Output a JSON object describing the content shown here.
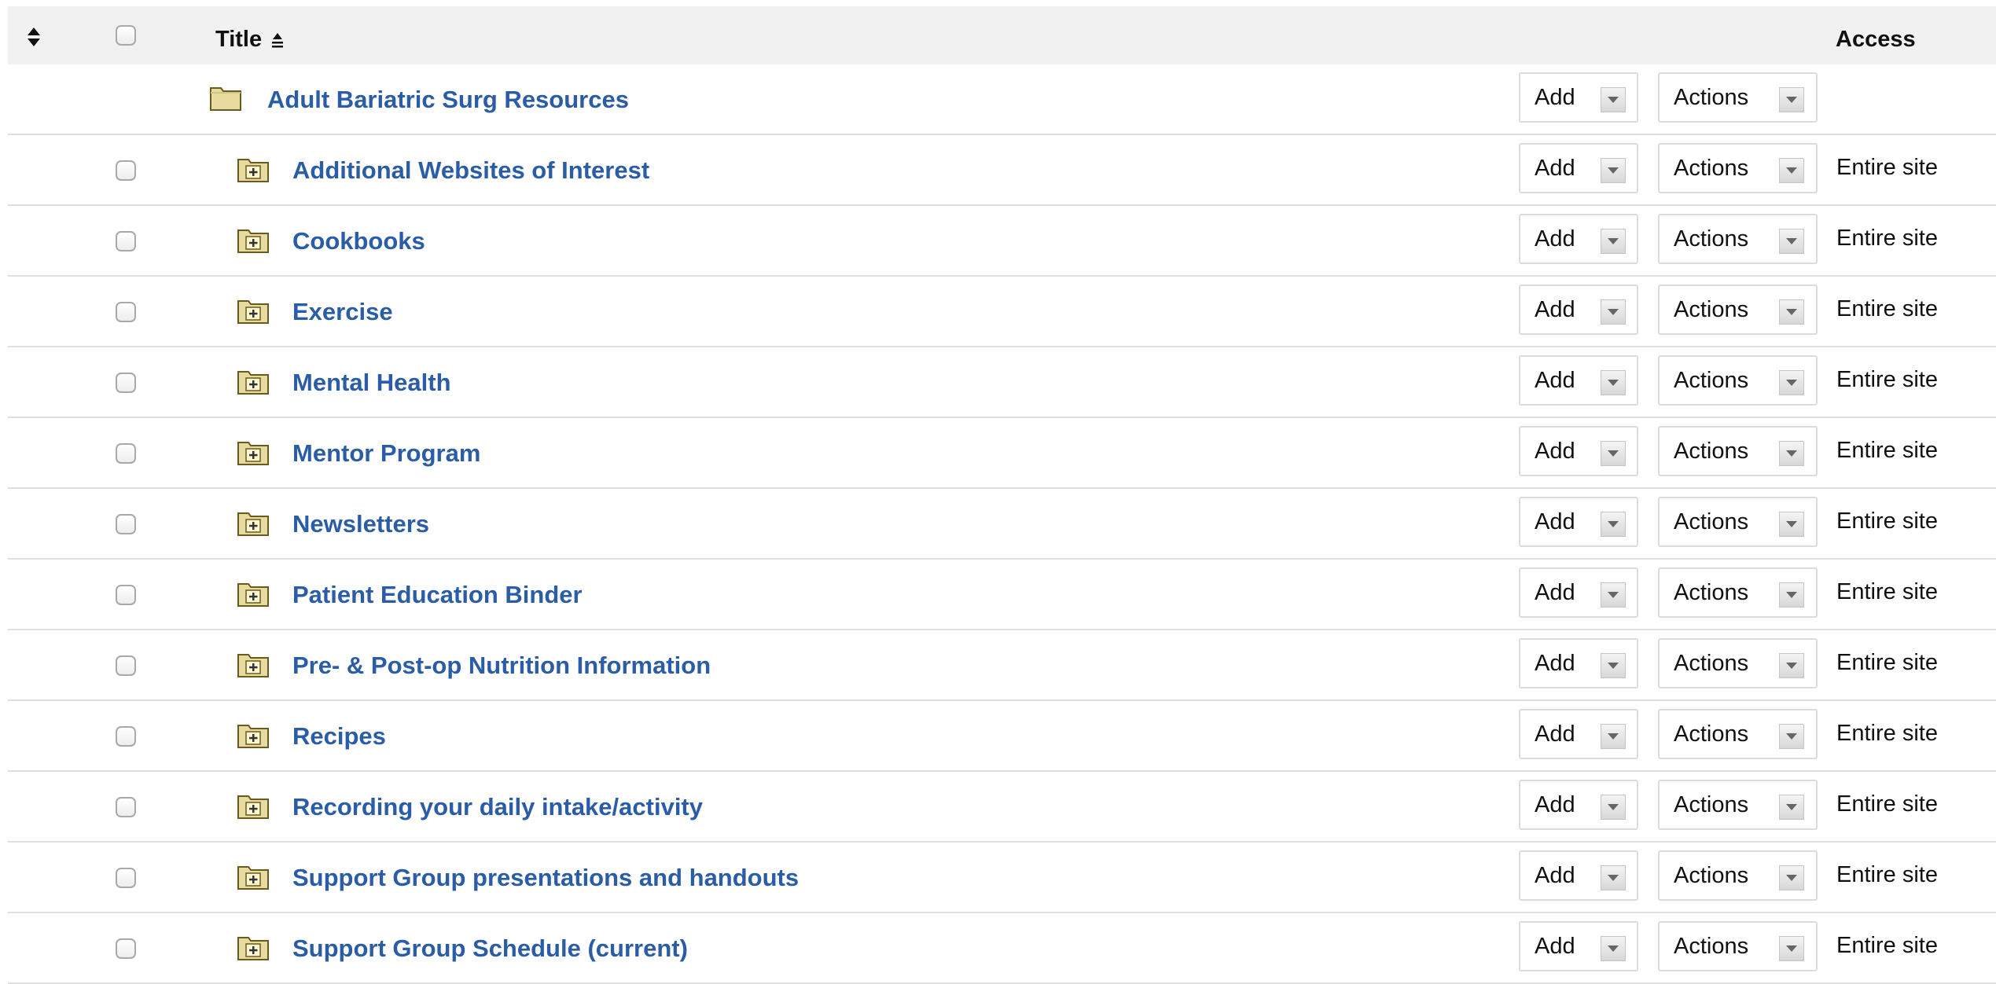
{
  "header": {
    "title": "Title",
    "access": "Access"
  },
  "buttons": {
    "add": "Add",
    "actions": "Actions"
  },
  "parent": {
    "label": "Adult Bariatric Surg Resources"
  },
  "items": [
    {
      "label": "Additional Websites of Interest",
      "access": "Entire site"
    },
    {
      "label": "Cookbooks",
      "access": "Entire site"
    },
    {
      "label": "Exercise",
      "access": "Entire site"
    },
    {
      "label": "Mental Health",
      "access": "Entire site"
    },
    {
      "label": "Mentor Program",
      "access": "Entire site"
    },
    {
      "label": "Newsletters",
      "access": "Entire site"
    },
    {
      "label": "Patient Education Binder",
      "access": "Entire site"
    },
    {
      "label": "Pre- & Post-op Nutrition Information",
      "access": "Entire site"
    },
    {
      "label": "Recipes",
      "access": "Entire site"
    },
    {
      "label": "Recording your daily intake/activity",
      "access": "Entire site"
    },
    {
      "label": "Support Group presentations and handouts",
      "access": "Entire site"
    },
    {
      "label": "Support Group Schedule (current)",
      "access": "Entire site"
    }
  ],
  "colors": {
    "link": "#2a5ca8",
    "header_bg": "#f1f1f1",
    "folder_fill": "#e8dba0",
    "folder_stroke": "#6b5a1e"
  },
  "icons": {
    "sort": "sort-both-icon",
    "title_sort": "sort-ascending-icon",
    "parent_folder": "folder-icon",
    "child_folder": "folder-expand-icon",
    "dropdown": "chevron-down-icon"
  }
}
